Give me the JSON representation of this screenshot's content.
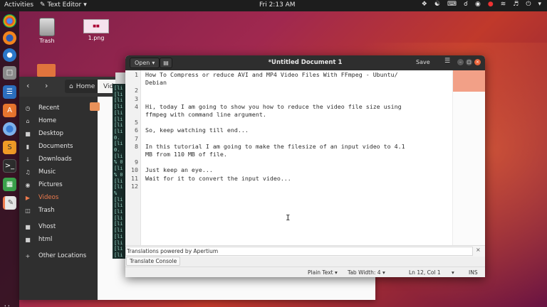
{
  "topbar": {
    "activities": "Activities",
    "app_name": "Text Editor",
    "clock": "Fri  2:13 AM",
    "tray_icons": [
      "dropbox-icon",
      "accessibility-icon",
      "keyboard-icon",
      "notification-icon",
      "chrome-icon",
      "record-icon",
      "wifi-icon",
      "volume-icon",
      "power-icon"
    ]
  },
  "desktop": {
    "trash_label": "Trash",
    "png_label": "1.png"
  },
  "dock": {
    "apps": [
      "chrome-icon",
      "firefox-icon",
      "thunderbird-icon",
      "files-icon",
      "writer-icon",
      "software-icon",
      "chromium-icon",
      "sublime-icon",
      "terminal-icon",
      "calc-icon",
      "text-editor-icon"
    ]
  },
  "files": {
    "path_home": "Home",
    "path_videos": "Vide",
    "sidebar": [
      "Recent",
      "Home",
      "Desktop",
      "Documents",
      "Downloads",
      "Music",
      "Pictures",
      "Videos",
      "Trash",
      "Vhost",
      "html",
      "Other Locations"
    ]
  },
  "editor": {
    "open_label": "Open",
    "title": "*Untitled Document 1",
    "save_label": "Save",
    "lines": [
      {
        "n": "1",
        "text": "How To Compress or reduce AVI and MP4 Video Files With FFmpeg - Ubuntu/"
      },
      {
        "n": "",
        "text": "Debian"
      },
      {
        "n": "2",
        "text": ""
      },
      {
        "n": "3",
        "text": ""
      },
      {
        "n": "4",
        "text": "Hi, today I am going to show you how to reduce the video file size using"
      },
      {
        "n": "",
        "text": "ffmpeg with command line argument."
      },
      {
        "n": "5",
        "text": ""
      },
      {
        "n": "6",
        "text": "So, keep watching till end..."
      },
      {
        "n": "7",
        "text": ""
      },
      {
        "n": "8",
        "text": "In this tutorial I am going to make the filesize of an input video to 4.1"
      },
      {
        "n": "",
        "text": "MB from 110 MB of file."
      },
      {
        "n": "9",
        "text": ""
      },
      {
        "n": "10",
        "text": "Just keep an eye..."
      },
      {
        "n": "11",
        "text": "Wait for it to convert the input video..."
      },
      {
        "n": "12",
        "text": ""
      }
    ],
    "translation_text": "Translations powered by Apertium",
    "translate_console": "Translate Console",
    "status": {
      "language": "Plain Text",
      "tab_width": "Tab Width: 4",
      "position": "Ln 12, Col 1",
      "mode": "INS"
    }
  },
  "terminal": {
    "lines": [
      "[li",
      "[li",
      "[li",
      "[li",
      "[li",
      "[li",
      "[li",
      "[li",
      "0.",
      "[li",
      "0.",
      "[li",
      "% 0",
      "[li",
      "% 0",
      "[li",
      "[li",
      "%",
      "[li",
      "[li",
      "[li",
      "[li",
      "[li",
      "[li",
      "[li",
      "[li",
      "[li",
      "[li"
    ]
  }
}
